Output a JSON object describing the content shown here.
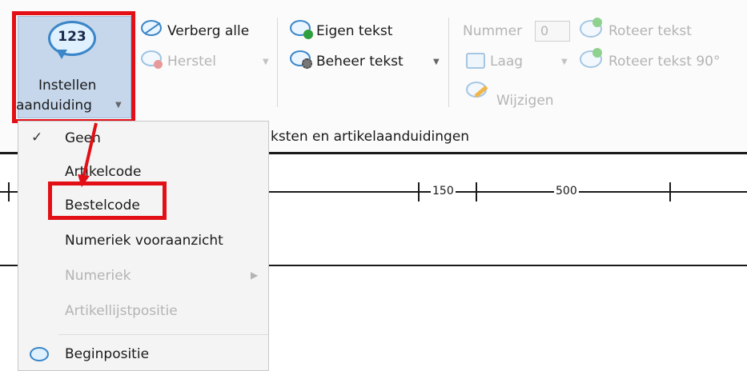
{
  "ribbon": {
    "instellen_line1": "Instellen",
    "instellen_line2": "aanduiding",
    "instellen_icon_text": "123",
    "verberg_alle": "Verberg alle",
    "herstel": "Herstel",
    "eigen_tekst": "Eigen tekst",
    "beheer_tekst": "Beheer tekst",
    "nummer_label": "Nummer",
    "nummer_value": "0",
    "laag": "Laag",
    "wijzigen": "Wijzigen",
    "roteer_tekst": "Roteer tekst",
    "roteer_tekst_90": "Roteer tekst 90°",
    "group_label_visible": "ksten en artikelaanduidingen"
  },
  "canvas": {
    "dim_a": "150",
    "dim_b": "500"
  },
  "menu": {
    "items": [
      {
        "label": "Geen",
        "checked": true,
        "enabled": true
      },
      {
        "label": "Artikelcode",
        "enabled": true
      },
      {
        "label": "Bestelcode",
        "enabled": true,
        "highlighted": true
      },
      {
        "label": "Numeriek vooraanzicht",
        "enabled": true
      },
      {
        "label": "Numeriek",
        "enabled": false,
        "submenu": true
      },
      {
        "label": "Artikellijstpositie",
        "enabled": false
      },
      {
        "label": "Beginpositie",
        "enabled": true,
        "icon": "speech-bubble-icon"
      }
    ]
  },
  "colors": {
    "highlight_red": "#e21016",
    "selected_button_bg": "#c6d7ec",
    "icon_blue": "#3a86c8",
    "disabled_text": "#b4b4b4"
  }
}
